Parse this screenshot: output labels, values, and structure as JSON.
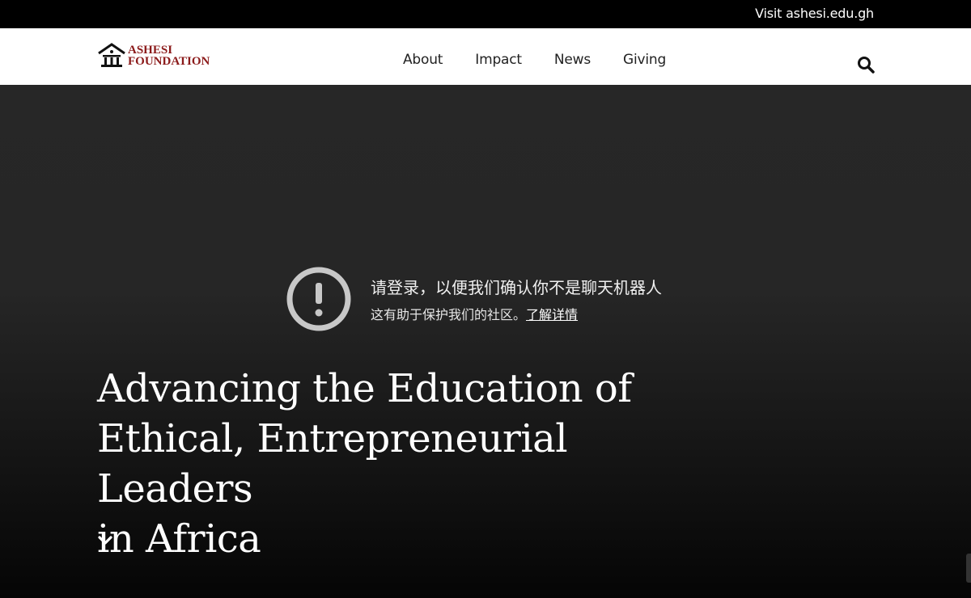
{
  "topbar": {
    "visit_link": "Visit ashesi.edu.gh"
  },
  "header": {
    "logo_line1": "ASHESI",
    "logo_line2": "FOUNDATION",
    "nav": [
      {
        "label": "About"
      },
      {
        "label": "Impact"
      },
      {
        "label": "News"
      },
      {
        "label": "Giving"
      }
    ]
  },
  "notice": {
    "title": "请登录，以便我们确认你不是聊天机器人",
    "subtitle": "这有助于保护我们的社区。",
    "learn_more": "了解详情"
  },
  "hero": {
    "headline_line1": "Advancing the Education of",
    "headline_line2": "Ethical, Entrepreneurial Leaders",
    "headline_line3": "in Africa"
  },
  "colors": {
    "brand": "#8b1a1a",
    "hero_bg": "#262626"
  }
}
